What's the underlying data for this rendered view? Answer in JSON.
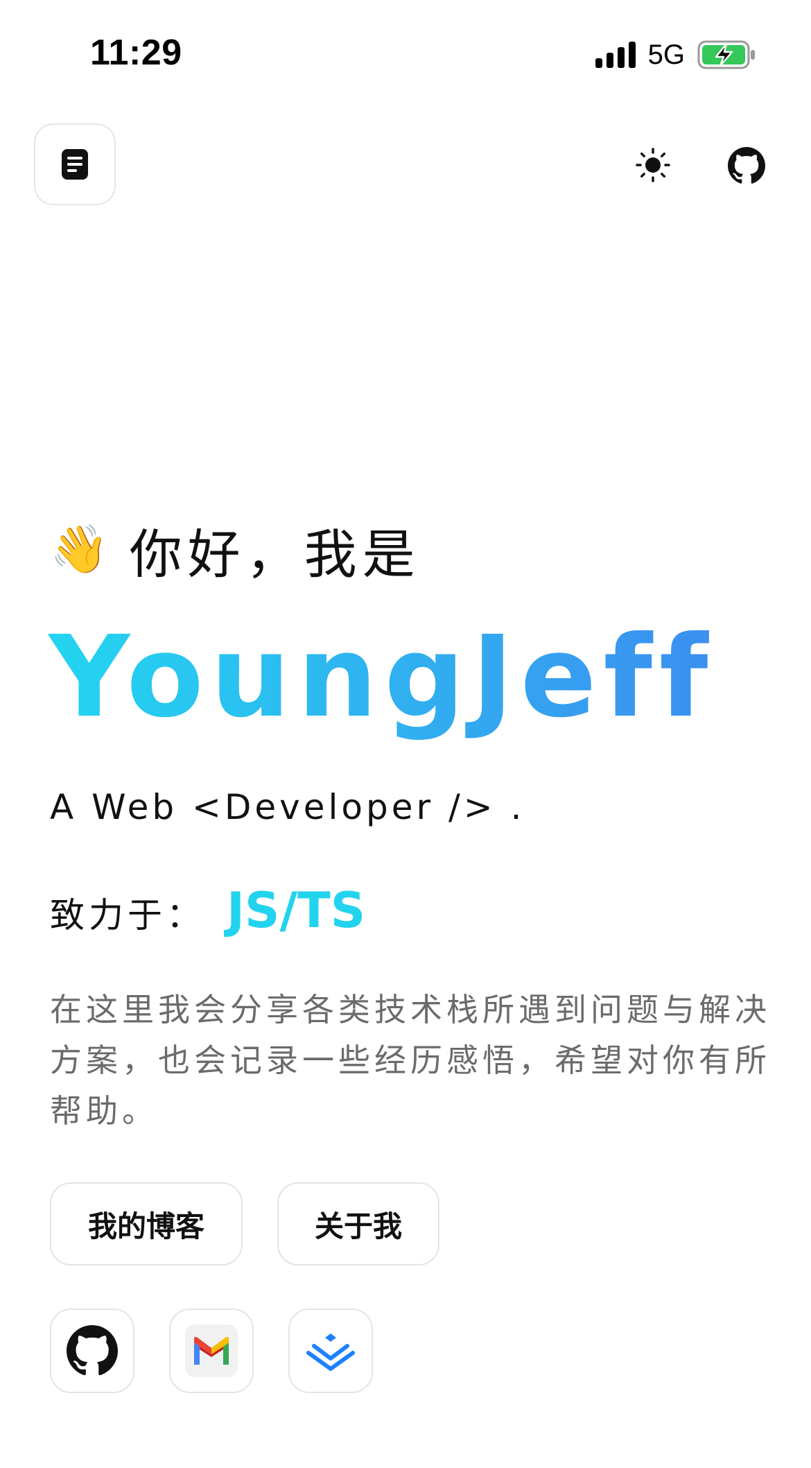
{
  "status_bar": {
    "time": "11:29",
    "network": "5G",
    "battery_color": "#34c759"
  },
  "nav": {
    "menu_icon": "document-list-icon",
    "theme_icon": "sun-icon",
    "github_icon": "github-icon"
  },
  "hero": {
    "wave_emoji": "👋",
    "greeting": "你好，我是",
    "name": "YoungJeff",
    "subtitle": "A Web <Developer /> .",
    "focus_label": "致力于：",
    "focus_value": "JS/TS",
    "description": "在这里我会分享各类技术栈所遇到问题与解决方案，也会记录一些经历感悟，希望对你有所帮助。"
  },
  "buttons": {
    "blog": "我的博客",
    "about": "关于我"
  },
  "social": {
    "github_icon": "github-icon",
    "gmail_icon": "gmail-icon",
    "juejin_icon": "juejin-icon"
  },
  "colors": {
    "gradient_start": "#23d5f0",
    "gradient_end": "#3b8ff0",
    "focus_accent": "#22d3ee",
    "text_muted": "#6b6b6b"
  }
}
